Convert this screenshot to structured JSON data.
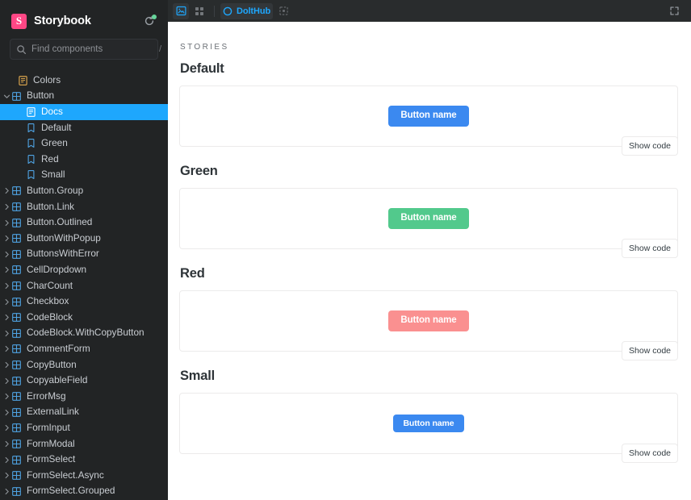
{
  "sidebar": {
    "brand": "Storybook",
    "brand_logo_letter": "S",
    "sync_icon": "refresh-icon",
    "sync_badge_color": "#66D49A",
    "search": {
      "placeholder": "Find components",
      "value": "",
      "shortcut_hint": "/",
      "icon": "search-icon"
    },
    "selected_item": "Docs",
    "selection_color": "#1EA7FD",
    "items": [
      {
        "label": "Colors",
        "icon": "document-icon",
        "indent": 1,
        "caret": "none",
        "selected": false
      },
      {
        "label": "Button",
        "icon": "component-icon",
        "indent": 0,
        "caret": "expanded",
        "selected": false
      },
      {
        "label": "Docs",
        "icon": "document-icon",
        "indent": 2,
        "caret": "none",
        "selected": true
      },
      {
        "label": "Default",
        "icon": "story-icon",
        "indent": 2,
        "caret": "none",
        "selected": false
      },
      {
        "label": "Green",
        "icon": "story-icon",
        "indent": 2,
        "caret": "none",
        "selected": false
      },
      {
        "label": "Red",
        "icon": "story-icon",
        "indent": 2,
        "caret": "none",
        "selected": false
      },
      {
        "label": "Small",
        "icon": "story-icon",
        "indent": 2,
        "caret": "none",
        "selected": false
      },
      {
        "label": "Button.Group",
        "icon": "component-icon",
        "indent": 0,
        "caret": "collapsed",
        "selected": false
      },
      {
        "label": "Button.Link",
        "icon": "component-icon",
        "indent": 0,
        "caret": "collapsed",
        "selected": false
      },
      {
        "label": "Button.Outlined",
        "icon": "component-icon",
        "indent": 0,
        "caret": "collapsed",
        "selected": false
      },
      {
        "label": "ButtonWithPopup",
        "icon": "component-icon",
        "indent": 0,
        "caret": "collapsed",
        "selected": false
      },
      {
        "label": "ButtonsWithError",
        "icon": "component-icon",
        "indent": 0,
        "caret": "collapsed",
        "selected": false
      },
      {
        "label": "CellDropdown",
        "icon": "component-icon",
        "indent": 0,
        "caret": "collapsed",
        "selected": false
      },
      {
        "label": "CharCount",
        "icon": "component-icon",
        "indent": 0,
        "caret": "collapsed",
        "selected": false
      },
      {
        "label": "Checkbox",
        "icon": "component-icon",
        "indent": 0,
        "caret": "collapsed",
        "selected": false
      },
      {
        "label": "CodeBlock",
        "icon": "component-icon",
        "indent": 0,
        "caret": "collapsed",
        "selected": false
      },
      {
        "label": "CodeBlock.WithCopyButton",
        "icon": "component-icon",
        "indent": 0,
        "caret": "collapsed",
        "selected": false
      },
      {
        "label": "CommentForm",
        "icon": "component-icon",
        "indent": 0,
        "caret": "collapsed",
        "selected": false
      },
      {
        "label": "CopyButton",
        "icon": "component-icon",
        "indent": 0,
        "caret": "collapsed",
        "selected": false
      },
      {
        "label": "CopyableField",
        "icon": "component-icon",
        "indent": 0,
        "caret": "collapsed",
        "selected": false
      },
      {
        "label": "ErrorMsg",
        "icon": "component-icon",
        "indent": 0,
        "caret": "collapsed",
        "selected": false
      },
      {
        "label": "ExternalLink",
        "icon": "component-icon",
        "indent": 0,
        "caret": "collapsed",
        "selected": false
      },
      {
        "label": "FormInput",
        "icon": "component-icon",
        "indent": 0,
        "caret": "collapsed",
        "selected": false
      },
      {
        "label": "FormModal",
        "icon": "component-icon",
        "indent": 0,
        "caret": "collapsed",
        "selected": false
      },
      {
        "label": "FormSelect",
        "icon": "component-icon",
        "indent": 0,
        "caret": "collapsed",
        "selected": false
      },
      {
        "label": "FormSelect.Async",
        "icon": "component-icon",
        "indent": 0,
        "caret": "collapsed",
        "selected": false
      },
      {
        "label": "FormSelect.Grouped",
        "icon": "component-icon",
        "indent": 0,
        "caret": "collapsed",
        "selected": false
      }
    ]
  },
  "toolbar": {
    "docs_view_icon": "docs-view-icon",
    "grid_view_icon": "grid-view-icon",
    "theme_label": "DoltHub",
    "theme_icon": "circle-icon",
    "measure_icon": "measure-icon",
    "fullscreen_icon": "fullscreen-icon",
    "accent_color": "#1EA7FD"
  },
  "main": {
    "section_label": "Stories",
    "show_code_label": "Show code",
    "stories": [
      {
        "title": "Default",
        "button_label": "Button name",
        "button_color": "#3B89F0",
        "size": "normal"
      },
      {
        "title": "Green",
        "button_label": "Button name",
        "button_color": "#52C98C",
        "size": "normal"
      },
      {
        "title": "Red",
        "button_label": "Button name",
        "button_color": "#FA9090",
        "size": "normal"
      },
      {
        "title": "Small",
        "button_label": "Button name",
        "button_color": "#3B89F0",
        "size": "small"
      }
    ]
  }
}
